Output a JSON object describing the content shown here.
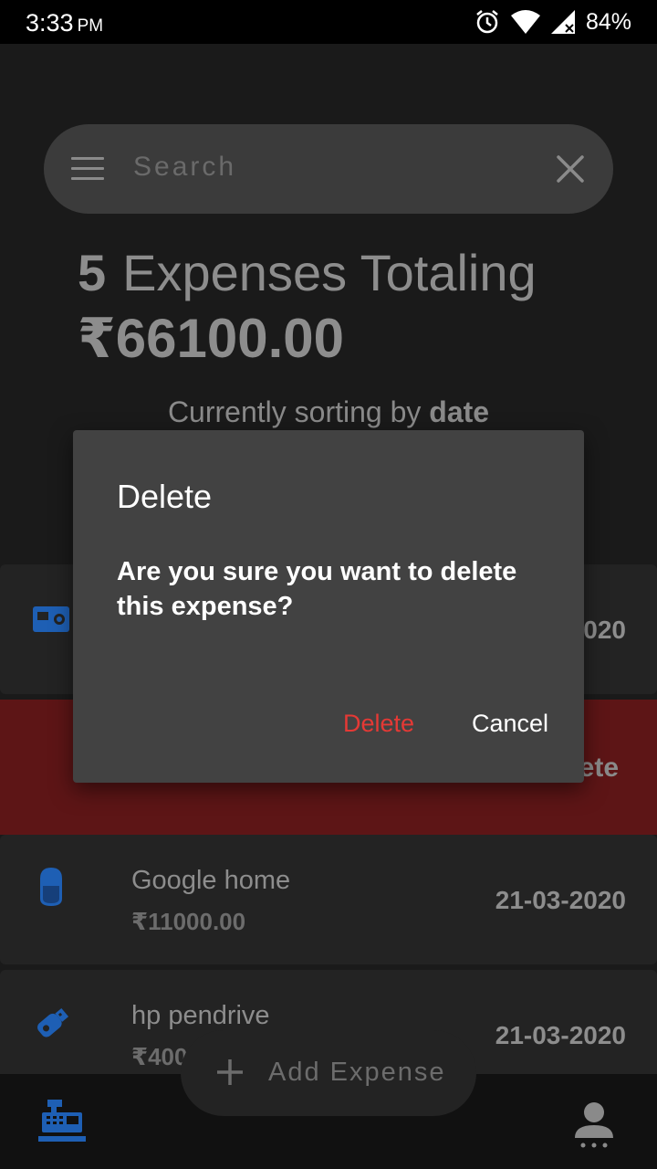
{
  "status_bar": {
    "time": "3:33",
    "ampm": "PM",
    "battery": "84%",
    "icons": [
      "alarm-icon",
      "wifi-icon",
      "signal-icon",
      "battery-icon"
    ]
  },
  "search": {
    "placeholder": "Search",
    "menu_icon": "menu-icon",
    "close_icon": "close-icon"
  },
  "summary": {
    "count": "5",
    "label": "Expenses Totaling",
    "total": "₹66100.00",
    "sort_prefix": "Currently sorting by",
    "sort_key": "date"
  },
  "expenses": [
    {
      "icon": "camera-icon",
      "title": "",
      "amount": "",
      "date": "020"
    },
    {
      "icon": "",
      "title": "",
      "amount": "",
      "date": "",
      "swipe_label": "ete"
    },
    {
      "icon": "smart-speaker-icon",
      "title": "Google home",
      "amount": "₹11000.00",
      "date": "21-03-2020"
    },
    {
      "icon": "usb-drive-icon",
      "title": "hp pendrive",
      "amount": "₹400",
      "date": "21-03-2020"
    }
  ],
  "fab": {
    "label": "Add Expense",
    "icon": "plus-icon"
  },
  "bottom_nav": {
    "items": [
      "cash-register-icon",
      "user-icon"
    ]
  },
  "dialog": {
    "title": "Delete",
    "message": "Are you sure you want to delete this expense?",
    "confirm_label": "Delete",
    "cancel_label": "Cancel"
  },
  "colors": {
    "accent": "#1e5fb4",
    "danger": "#e53935",
    "swipe_bg": "#5d1516",
    "dialog_bg": "#424242"
  }
}
